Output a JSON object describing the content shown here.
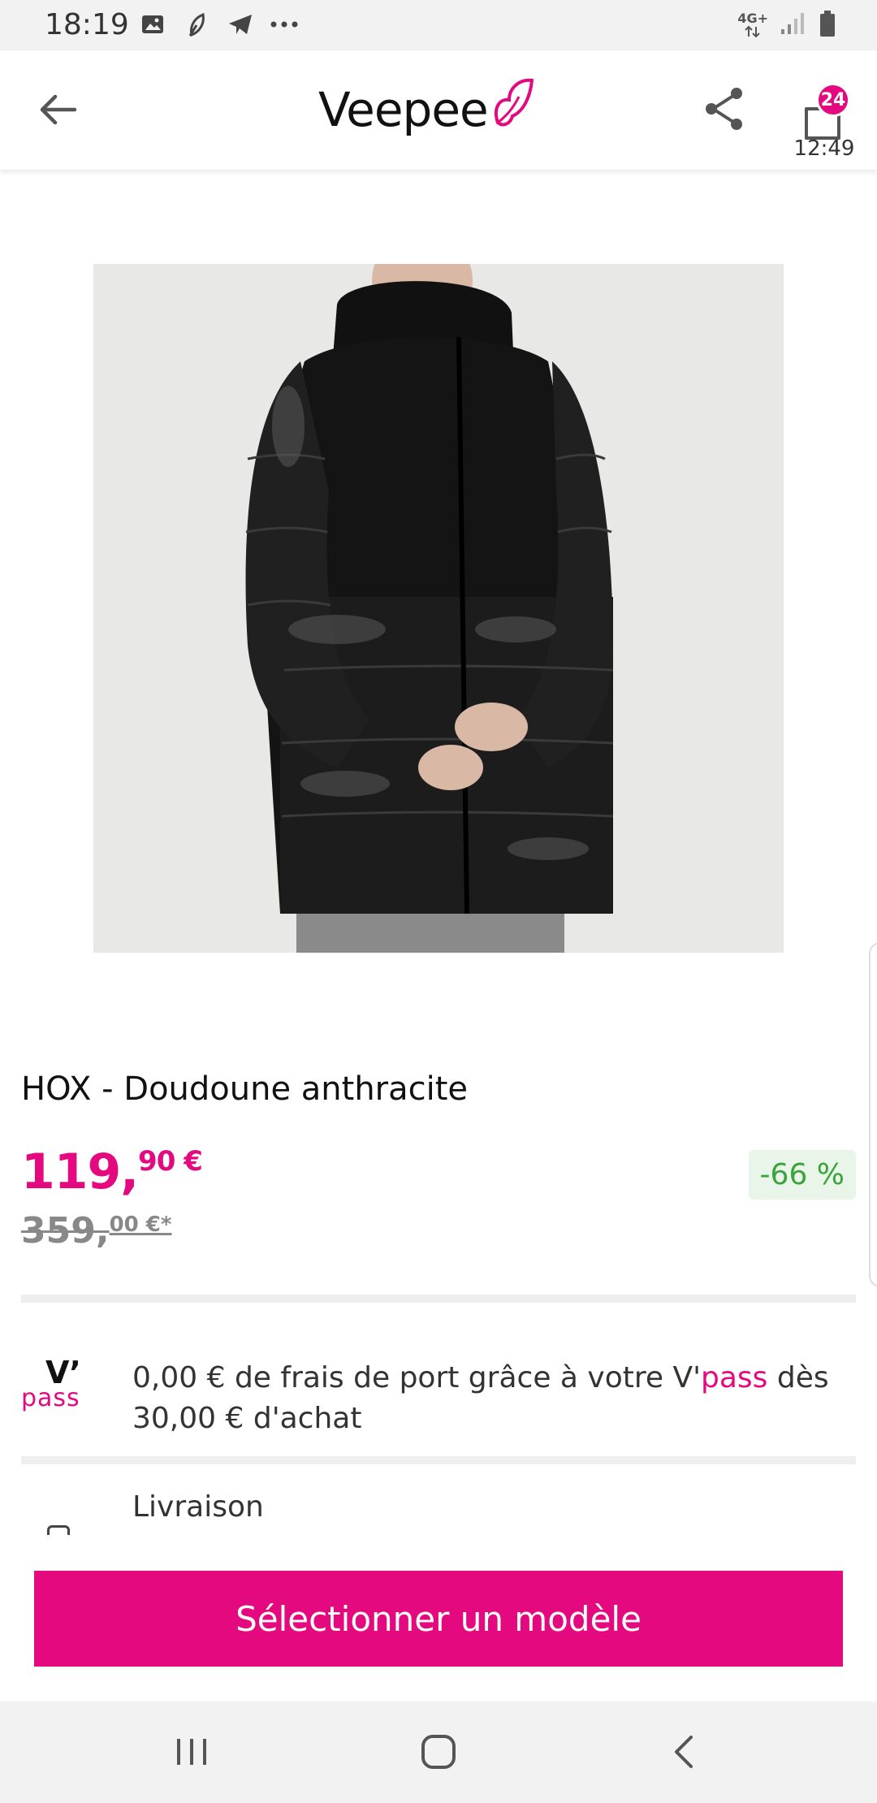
{
  "status_bar": {
    "time": "18:19",
    "network": "4G+",
    "left_icons": [
      "image-icon",
      "leaf-icon",
      "telegram-icon",
      "more-dots-icon"
    ],
    "right_icons": [
      "signal-icon",
      "battery-icon"
    ]
  },
  "app_bar": {
    "logo_text": "Veepee",
    "cart_count": "24",
    "cart_timer": "12:49",
    "accent_color": "#e5097f"
  },
  "product": {
    "title": "HOX - Doudoune anthracite",
    "price_int": "119,",
    "price_dec": "90 €",
    "old_price_int": "359,",
    "old_price_dec": "00 €*",
    "discount": "-66 %"
  },
  "vpass": {
    "logo_v": "V’",
    "logo_word": "pass",
    "text_before": "0,00 € de frais de port grâce à votre V'",
    "text_pink": "pass",
    "text_after": " dès 30,00 € d'achat"
  },
  "delivery": {
    "label": "Livraison"
  },
  "cta": {
    "label": "Sélectionner un modèle"
  },
  "nav_bar": {
    "items": [
      "recent-apps-icon",
      "home-icon",
      "back-icon"
    ]
  }
}
